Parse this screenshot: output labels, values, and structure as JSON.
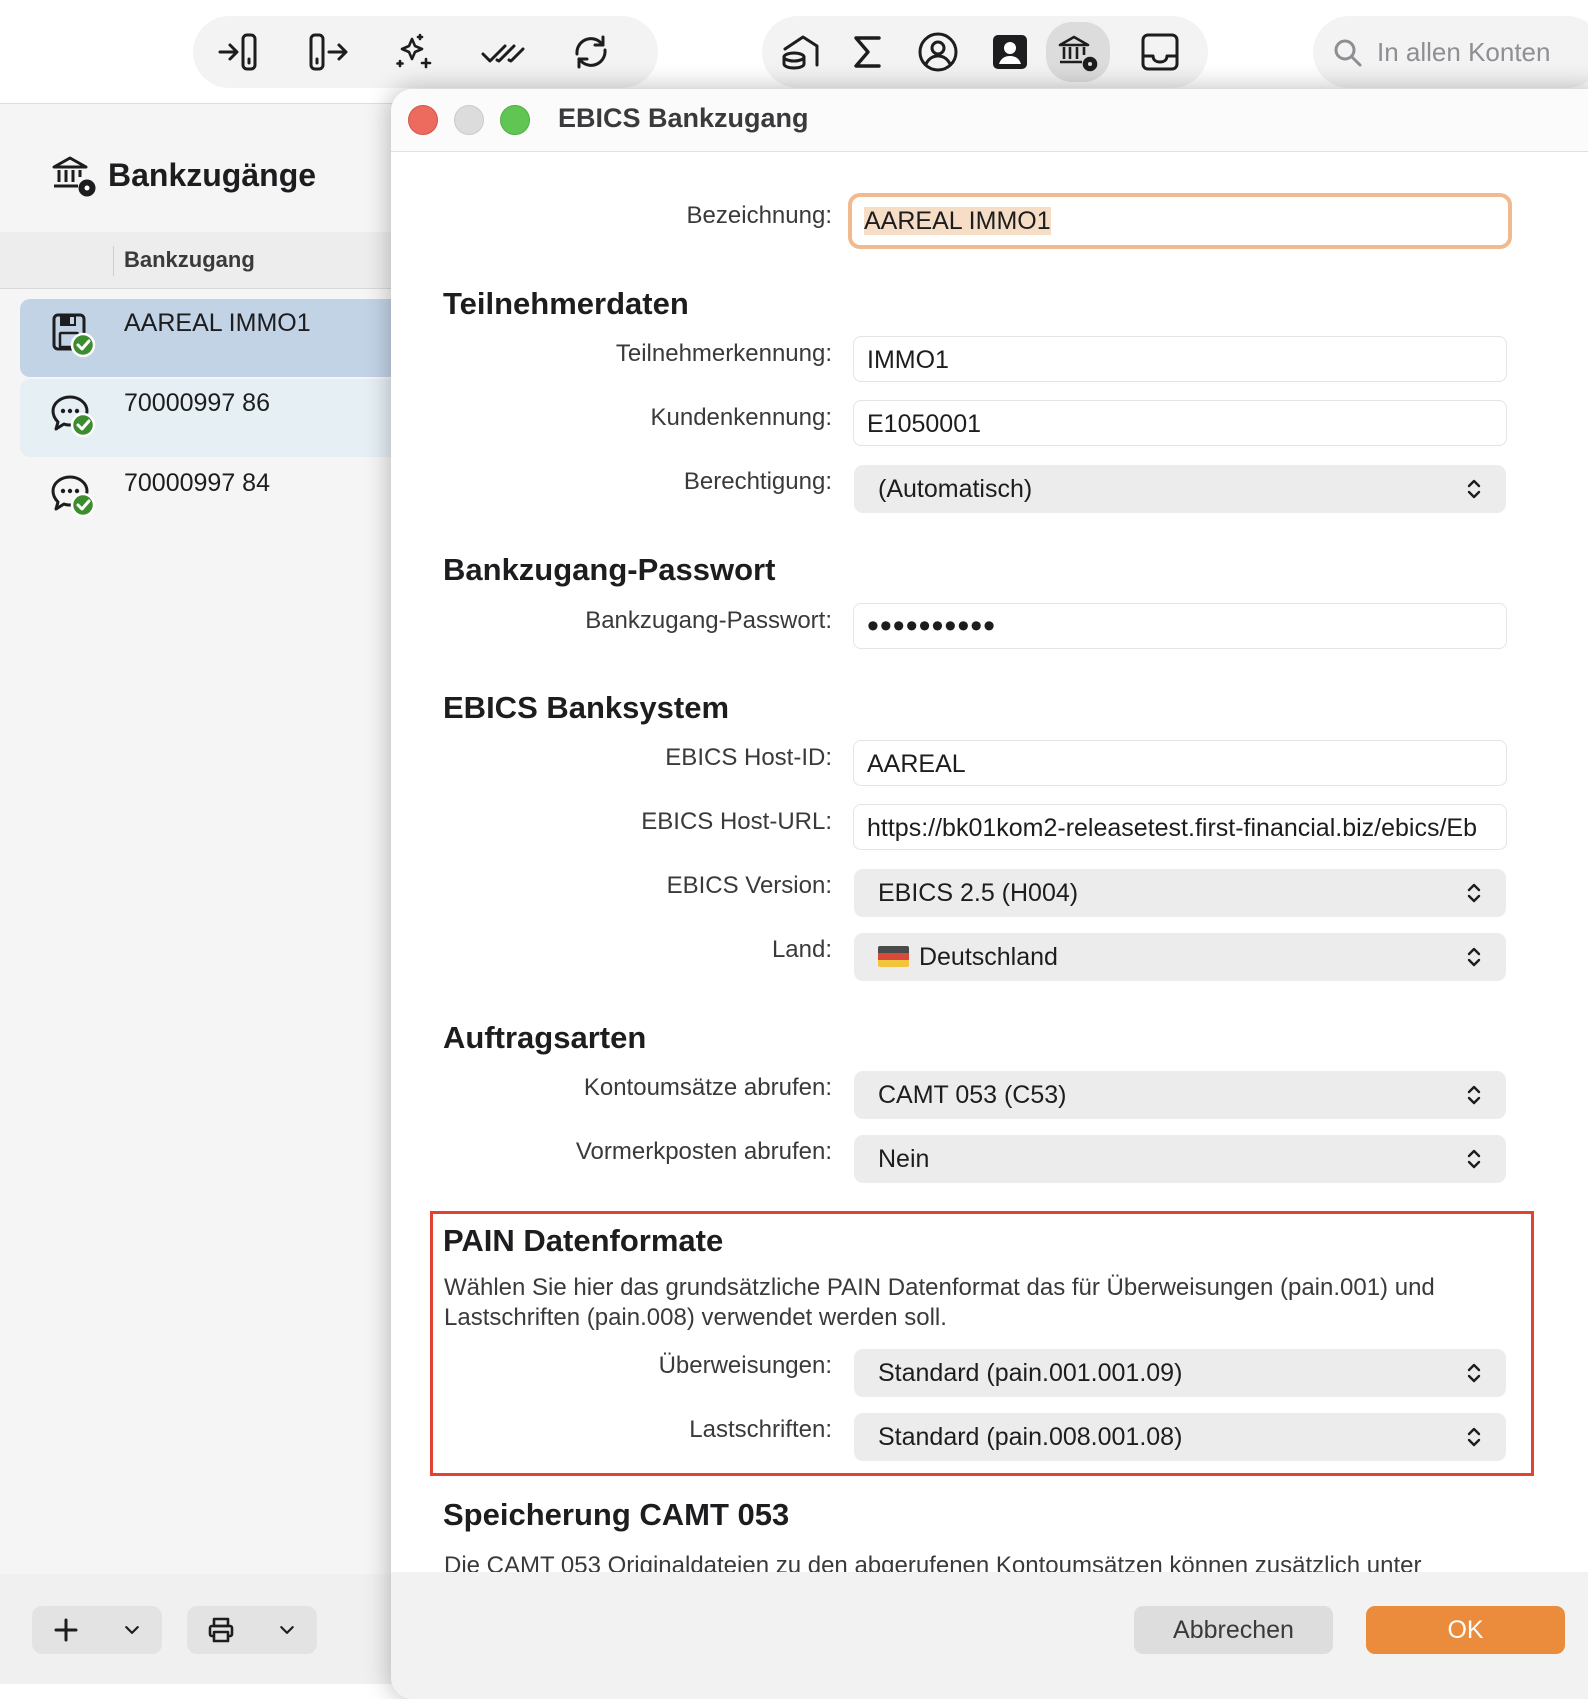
{
  "toolbar": {
    "group1": [
      "import-icon",
      "export-icon",
      "magic-icon",
      "double-check-icon",
      "sync-icon"
    ],
    "group2": [
      "bank-safe-icon",
      "sigma-icon",
      "user-circle-icon",
      "contact-card-icon",
      "bank-settings-icon",
      "inbox-icon"
    ],
    "search_placeholder": "In allen Konten"
  },
  "sidebar": {
    "title": "Bankzugänge",
    "column_header": "Bankzugang",
    "items": [
      {
        "label": "AAREAL IMMO1",
        "icon": "ebics-floppy-check-icon",
        "state": "selected"
      },
      {
        "label": "70000997 86",
        "icon": "chat-check-icon",
        "state": "alternate"
      },
      {
        "label": "70000997 84",
        "icon": "chat-check-icon",
        "state": "normal"
      }
    ]
  },
  "dialog": {
    "title": "EBICS Bankzugang",
    "bezeichnung_label": "Bezeichnung:",
    "bezeichnung_value": "AAREAL IMMO1",
    "sec_teilnehmer": "Teilnehmerdaten",
    "teilnehmerkennung_label": "Teilnehmerkennung:",
    "teilnehmerkennung_value": "IMMO1",
    "kundenkennung_label": "Kundenkennung:",
    "kundenkennung_value": "E1050001",
    "berechtigung_label": "Berechtigung:",
    "berechtigung_value": "(Automatisch)",
    "sec_passwort": "Bankzugang-Passwort",
    "passwort_label": "Bankzugang-Passwort:",
    "passwort_value": "••••••••••",
    "sec_banksystem": "EBICS Banksystem",
    "hostid_label": "EBICS Host-ID:",
    "hostid_value": "AAREAL",
    "hosturl_label": "EBICS Host-URL:",
    "hosturl_value": "https://bk01kom2-releasetest.first-financial.biz/ebics/Eb",
    "version_label": "EBICS Version:",
    "version_value": "EBICS 2.5 (H004)",
    "land_label": "Land:",
    "land_value": "Deutschland",
    "sec_auftragsarten": "Auftragsarten",
    "kontoumsaetze_label": "Kontoumsätze abrufen:",
    "kontoumsaetze_value": "CAMT 053 (C53)",
    "vormerkposten_label": "Vormerkposten abrufen:",
    "vormerkposten_value": "Nein",
    "sec_pain": "PAIN Datenformate",
    "pain_desc": "Wählen Sie hier das grundsätzliche PAIN Datenformat das für Überweisungen (pain.001) und Lastschriften (pain.008) verwendet werden soll.",
    "ueberweisungen_label": "Überweisungen:",
    "ueberweisungen_value": "Standard (pain.001.001.09)",
    "lastschriften_label": "Lastschriften:",
    "lastschriften_value": "Standard (pain.008.001.08)",
    "sec_camt": "Speicherung CAMT 053",
    "camt_desc": "Die CAMT 053 Originaldateien zu den abgerufenen Kontoumsätzen können zusätzlich unter",
    "cancel_label": "Abbrechen",
    "ok_label": "OK"
  },
  "colors": {
    "accent_ok": "#eb8c3c",
    "focus_ring": "#f0b98f",
    "highlight_box": "#e3422f",
    "selected_row": "#c2d3e6",
    "success_badge": "#3d8c2f"
  }
}
